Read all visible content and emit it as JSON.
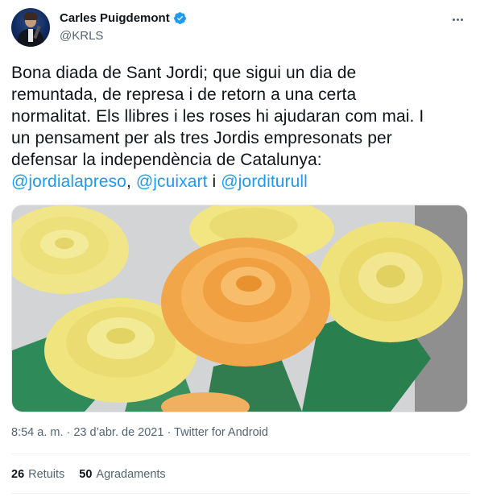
{
  "author": {
    "name": "Carles Puigdemont",
    "handle": "@KRLS",
    "verified_color": "#1d9bf0"
  },
  "tweet": {
    "lines": [
      "Bona diada de Sant Jordi; que sigui un dia de",
      "remuntada, de represa i de retorn a una certa",
      "normalitat. Els llibres i les roses hi ajudaran com mai. I",
      "un pensament per als tres Jordis empresonats per",
      "defensar la independència de Catalunya:"
    ],
    "mentions": [
      "@jordialapreso",
      "@jcuixart",
      "@jorditurull"
    ],
    "separator_1": ", ",
    "separator_2": " i "
  },
  "meta": {
    "text": "8:54 a. m. · 23 d’abr. de 2021 · Twitter for Android"
  },
  "stats": {
    "retweets_count": "26",
    "retweets_label": "Retuits",
    "likes_count": "50",
    "likes_label": "Agradaments"
  },
  "colors": {
    "mention": "#1d9bf0",
    "secondary_text": "#536471",
    "primary_text": "#0f1419"
  },
  "icons": {
    "more": "more-dots-icon",
    "verified": "verified-badge-icon"
  }
}
